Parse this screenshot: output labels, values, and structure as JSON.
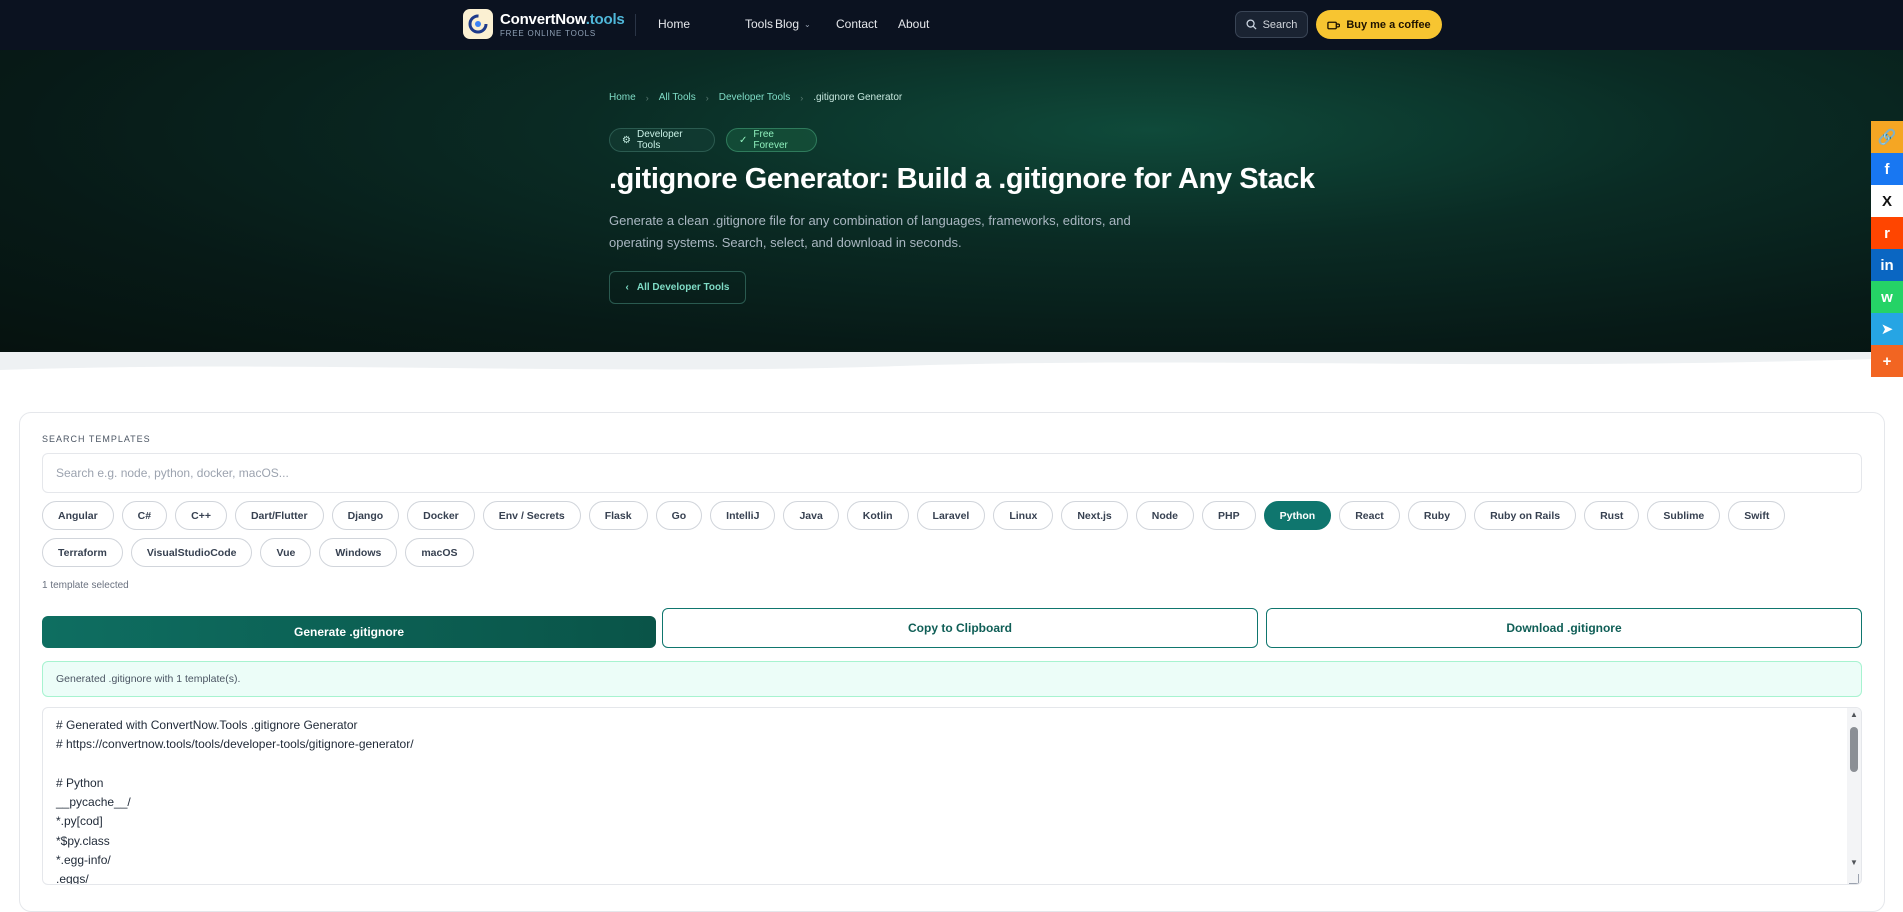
{
  "nav": {
    "brand_name": "ConvertNow",
    "brand_tld": ".tools",
    "brand_sub": "FREE ONLINE TOOLS",
    "links": [
      {
        "label": "Home",
        "dropdown": false
      },
      {
        "label": "Tools",
        "dropdown": true
      },
      {
        "label": "Blog",
        "dropdown": true
      },
      {
        "label": "Contact",
        "dropdown": false
      },
      {
        "label": "About",
        "dropdown": false
      }
    ],
    "search_label": "Search",
    "coffee_label": "Buy me a coffee"
  },
  "hero": {
    "breadcrumbs": [
      "Home",
      "All Tools",
      "Developer Tools",
      ".gitignore Generator"
    ],
    "badge_category": "Developer Tools",
    "badge_free": "Free Forever",
    "title": ".gitignore Generator: Build a .gitignore for Any Stack",
    "description": "Generate a clean .gitignore file for any combination of languages, frameworks, editors, and operating systems. Search, select, and download in seconds.",
    "back_label": "All Developer Tools"
  },
  "share": [
    {
      "icon": "copy-link-icon",
      "color": "#f5a623",
      "glyph": "🔗"
    },
    {
      "icon": "facebook-icon",
      "color": "#1877f2",
      "glyph": "f"
    },
    {
      "icon": "x-icon",
      "color": "#ffffff",
      "glyph": "X"
    },
    {
      "icon": "reddit-icon",
      "color": "#ff4500",
      "glyph": "r"
    },
    {
      "icon": "linkedin-icon",
      "color": "#0a66c2",
      "glyph": "in"
    },
    {
      "icon": "whatsapp-icon",
      "color": "#25d366",
      "glyph": "w"
    },
    {
      "icon": "telegram-icon",
      "color": "#26a5e4",
      "glyph": "➤"
    },
    {
      "icon": "more-share-icon",
      "color": "#f26522",
      "glyph": "+"
    }
  ],
  "tool": {
    "search_label": "SEARCH TEMPLATES",
    "search_placeholder": "Search e.g. node, python, docker, macOS...",
    "search_value": "",
    "templates": [
      "Angular",
      "C#",
      "C++",
      "Dart/Flutter",
      "Django",
      "Docker",
      "Env / Secrets",
      "Flask",
      "Go",
      "IntelliJ",
      "Java",
      "Kotlin",
      "Laravel",
      "Linux",
      "Next.js",
      "Node",
      "PHP",
      "Python",
      "React",
      "Ruby",
      "Ruby on Rails",
      "Rust",
      "Sublime",
      "Swift",
      "Terraform",
      "VisualStudioCode",
      "Vue",
      "Windows",
      "macOS"
    ],
    "selected": [
      "Python"
    ],
    "selected_count_label": "1 template selected",
    "generate_label": "Generate .gitignore",
    "copy_label": "Copy to Clipboard",
    "download_label": "Download .gitignore",
    "status": "Generated .gitignore with 1 template(s).",
    "output_lines": [
      "# Generated with ConvertNow.Tools .gitignore Generator",
      "# https://convertnow.tools/tools/developer-tools/gitignore-generator/",
      "",
      "# Python",
      "__pycache__/",
      "*.py[cod]",
      "*$py.class",
      "*.egg-info/",
      ".eggs/"
    ]
  }
}
